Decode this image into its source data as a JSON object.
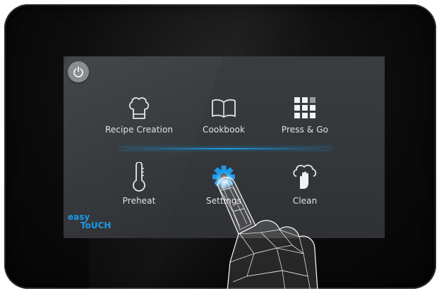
{
  "panel": {
    "power_icon": "power-icon",
    "brand": {
      "line1": "easy",
      "line2": "ToUCH"
    },
    "colors": {
      "accent": "#1a9be8",
      "screen": "#35383b",
      "bezel": "#0b0b0b"
    },
    "menu": [
      {
        "id": "recipe-creation",
        "label": "Recipe Creation",
        "icon": "chef-hat-icon"
      },
      {
        "id": "cookbook",
        "label": "Cookbook",
        "icon": "open-book-icon"
      },
      {
        "id": "press-and-go",
        "label": "Press & Go",
        "icon": "grid-icon"
      },
      {
        "id": "preheat",
        "label": "Preheat",
        "icon": "thermometer-icon"
      },
      {
        "id": "settings",
        "label": "Settings",
        "icon": "gear-icon"
      },
      {
        "id": "clean",
        "label": "Clean",
        "icon": "cleaning-hand-icon"
      }
    ]
  }
}
